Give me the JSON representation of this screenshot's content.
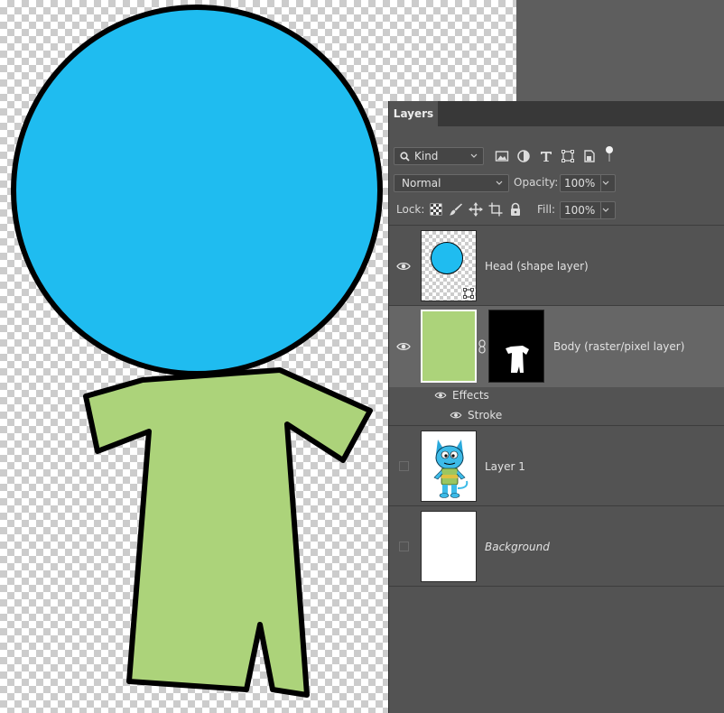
{
  "colors": {
    "head_fill": "#1fbcf0",
    "body_fill": "#acd37a",
    "outline": "#000000",
    "panel_bg": "#535353",
    "selected_row": "#666666"
  },
  "panel": {
    "tab_label": "Layers",
    "filter": {
      "icon": "search-icon",
      "value": "Kind"
    },
    "filter_icons": [
      "image-filter-icon",
      "adjustment-filter-icon",
      "type-filter-icon",
      "shape-filter-icon",
      "smart-object-filter-icon",
      "filter-toggle-icon"
    ],
    "blend_mode": "Normal",
    "opacity_label": "Opacity:",
    "opacity_value": "100%",
    "lock_label": "Lock:",
    "lock_icons": [
      "lock-transparent-icon",
      "lock-pixels-icon",
      "lock-position-icon",
      "lock-artboard-icon",
      "lock-all-icon"
    ],
    "fill_label": "Fill:",
    "fill_value": "100%"
  },
  "layers": [
    {
      "name": "Head (shape layer)",
      "visible": true,
      "selected": false
    },
    {
      "name": "Body (raster/pixel layer)",
      "visible": true,
      "selected": true,
      "effects_label": "Effects",
      "stroke_label": "Stroke"
    },
    {
      "name": "Layer 1",
      "visible": false,
      "selected": false
    },
    {
      "name": "Background",
      "visible": false,
      "selected": false,
      "italic": true
    }
  ]
}
